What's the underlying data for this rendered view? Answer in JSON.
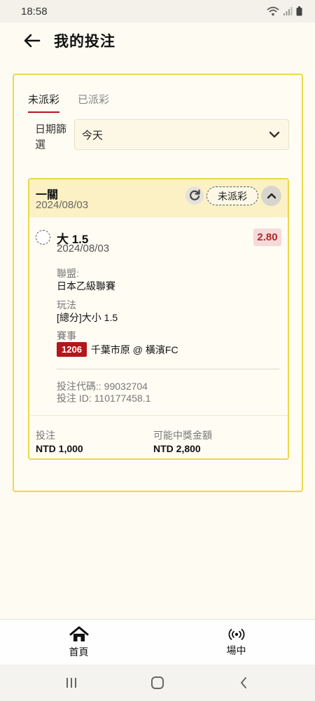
{
  "status_bar": {
    "time": "18:58"
  },
  "header": {
    "title": "我的投注"
  },
  "tabs": [
    {
      "label": "未派彩",
      "active": true
    },
    {
      "label": "已派彩",
      "active": false
    }
  ],
  "filter": {
    "label": "日期篩選",
    "value": "今天"
  },
  "bet_card": {
    "title": "一關",
    "date": "2024/08/03",
    "status": "未派彩",
    "pick": {
      "name": "大 1.5",
      "date": "2024/08/03",
      "odds": "2.80"
    },
    "league_label": "聯盟:",
    "league_value": "日本乙級聯賽",
    "market_label": "玩法",
    "market_value": "[總分]大小 1.5",
    "event_label": "賽事",
    "match_id": "1206",
    "match_name": "千葉市原 @ 橫濱FC",
    "bet_code": "投注代碼:: 99032704",
    "bet_id": "投注 ID: 110177458.1",
    "stake_label": "投注",
    "stake_value": "NTD 1,000",
    "payout_label": "可能中獎金額",
    "payout_value": "NTD 2,800"
  },
  "bottom_nav": [
    {
      "label": "首頁",
      "icon": "home-icon"
    },
    {
      "label": "場中",
      "icon": "live-broadcast-icon"
    }
  ],
  "colors": {
    "accent_red": "#b5161b",
    "card_border": "#ead94a",
    "card_header": "#fbf1c5",
    "odds_bg": "#f6dada"
  }
}
